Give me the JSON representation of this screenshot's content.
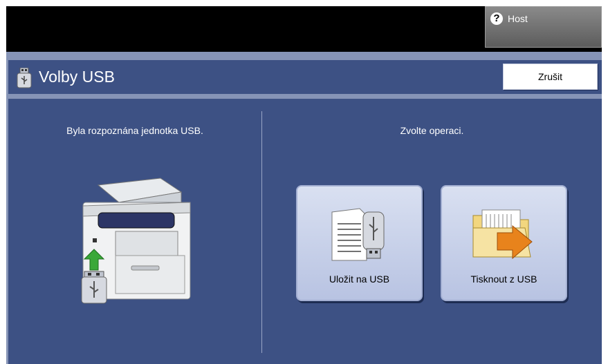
{
  "topbar": {
    "host_label": "Host",
    "help_icon": "question-mark-icon"
  },
  "header": {
    "title": "Volby USB",
    "cancel_label": "Zrušit",
    "icon": "usb-drive-icon"
  },
  "left_panel": {
    "message": "Byla rozpoznána jednotka USB.",
    "illustration": "printer-with-usb-icon"
  },
  "right_panel": {
    "prompt": "Zvolte operaci.",
    "actions": [
      {
        "label": "Uložit na USB",
        "icon": "save-to-usb-icon"
      },
      {
        "label": "Tisknout z USB",
        "icon": "print-from-usb-icon"
      }
    ]
  },
  "colors": {
    "panel_bg": "#3d5184",
    "frame_bg": "#8694b6",
    "button_bg": "#c9d2ec",
    "arrow_green": "#3aa838",
    "arrow_orange": "#e8831c"
  }
}
